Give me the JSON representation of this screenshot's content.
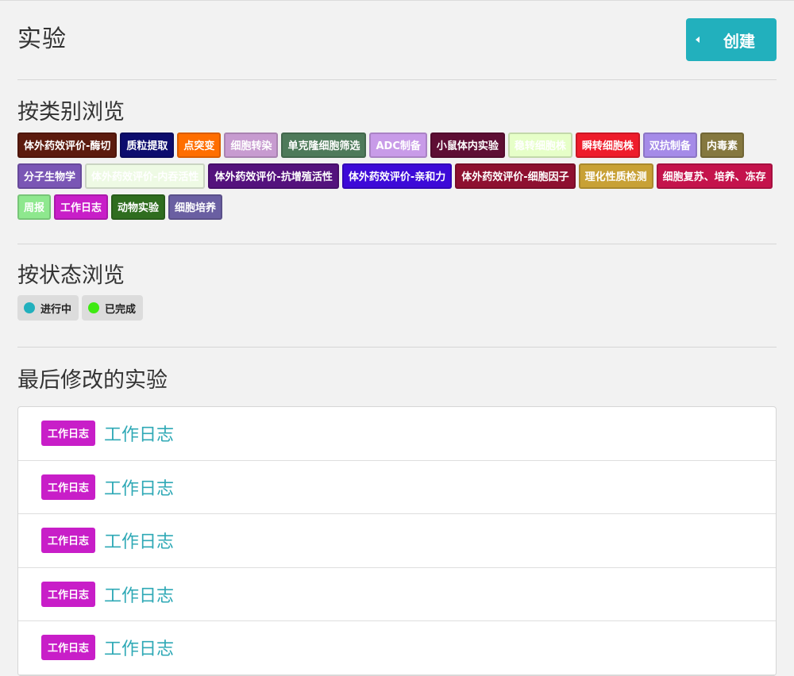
{
  "header": {
    "title": "实验",
    "create_label": "创建"
  },
  "categories": {
    "title": "按类别浏览",
    "tags": [
      {
        "label": "体外药效评价-酶切",
        "color": "#5c1b0e"
      },
      {
        "label": "质粒提取",
        "color": "#0d0d6e"
      },
      {
        "label": "点突变",
        "color": "#ff6e00"
      },
      {
        "label": "细胞转染",
        "color": "#c79bd0"
      },
      {
        "label": "单克隆细胞筛选",
        "color": "#4e7a5a"
      },
      {
        "label": "ADC制备",
        "color": "#c89be8"
      },
      {
        "label": "小鼠体内实验",
        "color": "#5e0e34"
      },
      {
        "label": "稳转细胞株",
        "color": "#e6ffc8"
      },
      {
        "label": "瞬转细胞株",
        "color": "#ee1c2b"
      },
      {
        "label": "双抗制备",
        "color": "#a58be8"
      },
      {
        "label": "内毒素",
        "color": "#85783f"
      },
      {
        "label": "分子生物学",
        "color": "#7a56b5"
      },
      {
        "label": "体外药效评价-内吞活性",
        "color": "#eefae4"
      },
      {
        "label": "体外药效评价-抗增殖活性",
        "color": "#54127d"
      },
      {
        "label": "体外药效评价-亲和力",
        "color": "#3d0ad8"
      },
      {
        "label": "体外药效评价-细胞因子",
        "color": "#8e1030"
      },
      {
        "label": "理化性质检测",
        "color": "#c8a136"
      },
      {
        "label": "细胞复苏、培养、冻存",
        "color": "#c4134c"
      },
      {
        "label": "周报",
        "color": "#8ee88e"
      },
      {
        "label": "工作日志",
        "color": "#c81ec8"
      },
      {
        "label": "动物实验",
        "color": "#2f6d1f"
      },
      {
        "label": "细胞培养",
        "color": "#6a5fa2"
      }
    ]
  },
  "status": {
    "title": "按状态浏览",
    "items": [
      {
        "label": "进行中",
        "color": "#22b0bd"
      },
      {
        "label": "已完成",
        "color": "#3eea12"
      }
    ]
  },
  "recent": {
    "title": "最后修改的实验",
    "items": [
      {
        "tag": "工作日志",
        "tag_color": "#c81ec8",
        "title": "工作日志"
      },
      {
        "tag": "工作日志",
        "tag_color": "#c81ec8",
        "title": "工作日志"
      },
      {
        "tag": "工作日志",
        "tag_color": "#c81ec8",
        "title": "工作日志"
      },
      {
        "tag": "工作日志",
        "tag_color": "#c81ec8",
        "title": "工作日志"
      },
      {
        "tag": "工作日志",
        "tag_color": "#c81ec8",
        "title": "工作日志"
      }
    ]
  }
}
